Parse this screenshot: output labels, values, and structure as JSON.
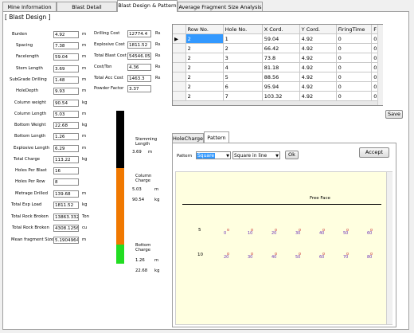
{
  "tabs": [
    {
      "label": "Mine Information"
    },
    {
      "label": "Blast Detail"
    },
    {
      "label": "Blast Design & Pattern"
    },
    {
      "label": "Average Fragment Size Analysis"
    }
  ],
  "design": {
    "title": "[ Blast Design ]",
    "fields": [
      {
        "label": "Burden",
        "value": "4.92",
        "unit": "m"
      },
      {
        "label": "Spacing",
        "value": "7.38",
        "unit": "m"
      },
      {
        "label": "Facelength",
        "value": "59.04",
        "unit": "m"
      },
      {
        "label": "Stem Length",
        "value": "3.69",
        "unit": "m"
      },
      {
        "label": "SubGrade Drilling",
        "value": "1.48",
        "unit": "m"
      },
      {
        "label": "HoleDepth",
        "value": "9.93",
        "unit": "m"
      },
      {
        "label": "Column weight",
        "value": "90.54",
        "unit": "kg"
      },
      {
        "label": "Column Length",
        "value": "5.03",
        "unit": "m"
      },
      {
        "label": "Bottom Weight",
        "value": "22.68",
        "unit": "kg"
      },
      {
        "label": "Bottom Length",
        "value": "1.26",
        "unit": "m"
      },
      {
        "label": "Explosive Length",
        "value": "6.29",
        "unit": "m"
      },
      {
        "label": "Total Charge",
        "value": "113.22",
        "unit": "kg"
      },
      {
        "label": "Holes Per Blast",
        "value": "16",
        "unit": ""
      },
      {
        "label": "Holes Per Row",
        "value": "8",
        "unit": ""
      },
      {
        "label": "Metrage Drilled",
        "value": "139.68",
        "unit": "m"
      },
      {
        "label": "Total Exp Load",
        "value": "1811.52",
        "unit": "kg"
      },
      {
        "label": "Total Rock Broken",
        "value": "13863.3323",
        "unit": "Ton"
      },
      {
        "label": "Total Rock Broken",
        "value": "4308.1256",
        "unit": "cu"
      },
      {
        "label": "Mean fragment Size",
        "value": "5.19049643",
        "unit": "m"
      }
    ],
    "costs": [
      {
        "label": "Drilling Cost",
        "value": "12774.4",
        "unit": "Rs"
      },
      {
        "label": "Explosive Cost",
        "value": "1811.52",
        "unit": "Rs"
      },
      {
        "label": "Total Blast Cost",
        "value": "54546.05",
        "unit": "Rs"
      },
      {
        "label": "Cost/Ton",
        "value": "4.36",
        "unit": "Rs"
      },
      {
        "label": "Total Acc Cost",
        "value": "1463.3",
        "unit": "Rs"
      },
      {
        "label": "Powder Factor",
        "value": "3.37",
        "unit": ""
      }
    ]
  },
  "column_diagram": {
    "stemming": {
      "label": "Stemming Length",
      "value": "3.69",
      "unit": "m",
      "color": "#000000"
    },
    "column": {
      "label": "Column Charge",
      "length": "5.03",
      "length_unit": "m",
      "weight": "90.54",
      "weight_unit": "kg",
      "color": "#f07800"
    },
    "bottom": {
      "label": "Bottom Charge",
      "length": "1.26",
      "length_unit": "m",
      "weight": "22.68",
      "weight_unit": "kg",
      "color": "#22dd22"
    }
  },
  "grid": {
    "headers": [
      "Row No.",
      "Hole No.",
      "X Cord.",
      "Y Cord.",
      "FiringTime",
      "F"
    ],
    "rows": [
      [
        "2",
        "1",
        "59.04",
        "4.92",
        "0",
        "0"
      ],
      [
        "2",
        "2",
        "66.42",
        "4.92",
        "0",
        "0"
      ],
      [
        "2",
        "3",
        "73.8",
        "4.92",
        "0",
        "0"
      ],
      [
        "2",
        "4",
        "81.18",
        "4.92",
        "0",
        "0"
      ],
      [
        "2",
        "5",
        "88.56",
        "4.92",
        "0",
        "0"
      ],
      [
        "2",
        "6",
        "95.94",
        "4.92",
        "0",
        "0"
      ],
      [
        "2",
        "7",
        "103.32",
        "4.92",
        "0",
        "0"
      ]
    ],
    "save_label": "Save"
  },
  "pattern": {
    "tabs": [
      "HoleCharge",
      "Pattern"
    ],
    "pattern_label": "Pattern",
    "pattern_value": "Square",
    "layout_value": "Square in line",
    "ok_label": "Ok",
    "accept_label": "Accept",
    "free_face": "Free Face",
    "row5_label": "5",
    "row10_label": "10",
    "row5_holes": [
      "0",
      "10",
      "20",
      "30",
      "40",
      "50",
      "60"
    ],
    "row10_holes": [
      "20",
      "30",
      "40",
      "50",
      "60",
      "70",
      "80"
    ]
  },
  "colors": {
    "selection": "#3399ff",
    "canvas": "#ffffe0",
    "hole_text": "#6a2fb8",
    "hole_marker": "#c83232"
  }
}
